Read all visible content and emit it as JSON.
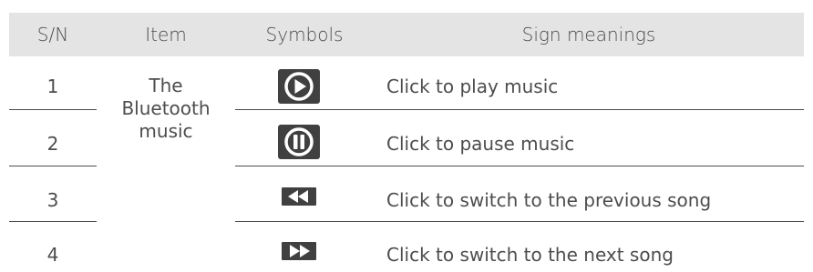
{
  "table": {
    "headers": {
      "sn": "S/N",
      "item": "Item",
      "symbols": "Symbols",
      "meanings": "Sign meanings"
    },
    "item_name": "The\nBluetooth\nmusic",
    "rows": [
      {
        "sn": "1",
        "symbol_icon": "play-icon",
        "meaning": "Click to play music"
      },
      {
        "sn": "2",
        "symbol_icon": "pause-icon",
        "meaning": "Click to pause music"
      },
      {
        "sn": "3",
        "symbol_icon": "previous-song-icon",
        "meaning": "Click to switch to the previous song"
      },
      {
        "sn": "4",
        "symbol_icon": "next-song-icon",
        "meaning": "Click to switch to the next song"
      }
    ]
  },
  "colors": {
    "header_bg": "#e4e4e4",
    "icon_bg": "#404040",
    "icon_fg": "#ffffff",
    "text": "#4d4d4d"
  }
}
